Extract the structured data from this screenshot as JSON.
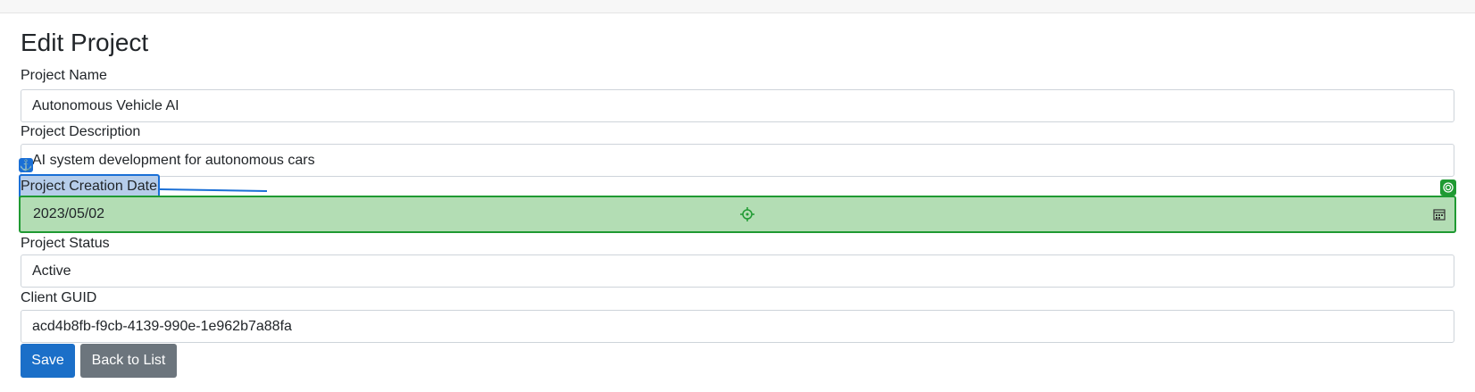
{
  "page": {
    "title": "Edit Project"
  },
  "form": {
    "project_name": {
      "label": "Project Name",
      "value": "Autonomous Vehicle AI"
    },
    "project_description": {
      "label": "Project Description",
      "value": "AI system development for autonomous cars"
    },
    "project_creation_date": {
      "label": "Project Creation Date",
      "value": "2023/05/02"
    },
    "project_status": {
      "label": "Project Status",
      "value": "Active"
    },
    "client_guid": {
      "label": "Client GUID",
      "value": "acd4b8fb-f9cb-4139-990e-1e962b7a88fa"
    }
  },
  "actions": {
    "save_label": "Save",
    "back_label": "Back to List"
  },
  "overlay": {
    "anchor_color": "#1a6fd6",
    "target_color": "#1f9a32",
    "anchor_icon": "anchor-icon",
    "target_icon": "target-icon",
    "crosshair_icon": "crosshair-icon"
  }
}
